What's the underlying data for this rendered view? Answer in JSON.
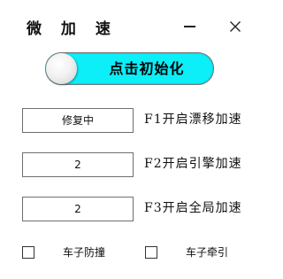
{
  "window": {
    "title": "微 加 速",
    "minimize_icon": "minimize-icon",
    "close_icon": "close-icon"
  },
  "toggle": {
    "label": "点击初始化",
    "state": "on",
    "track_color": "#0ceef8"
  },
  "hotkeys": [
    {
      "field_value": "修复中",
      "label": "F1开启漂移加速"
    },
    {
      "field_value": "2",
      "label": "F2开启引擎加速"
    },
    {
      "field_value": "2",
      "label": "F3开启全局加速"
    }
  ],
  "checkboxes": [
    {
      "label": "车子防撞",
      "checked": false
    },
    {
      "label": "车子牵引",
      "checked": false
    }
  ]
}
